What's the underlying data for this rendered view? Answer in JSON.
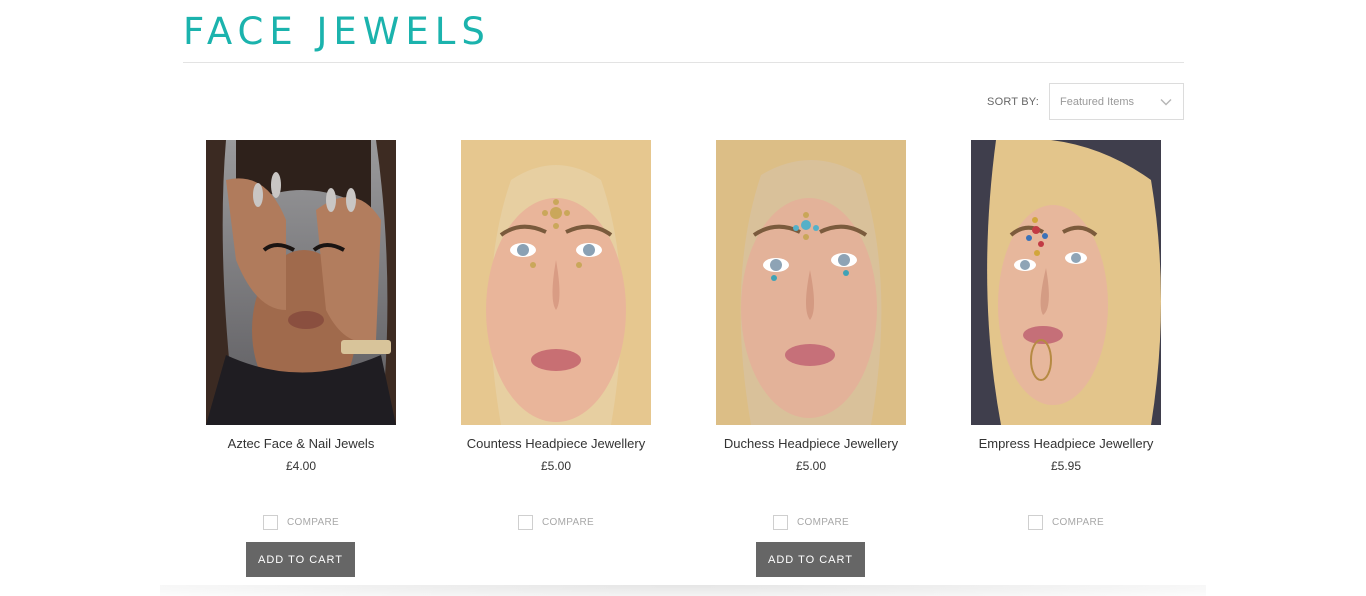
{
  "page": {
    "title": "FACE JEWELS",
    "accent_color": "#1bb3ad"
  },
  "sort": {
    "label": "SORT BY:",
    "selected": "Featured Items",
    "icon": "chevron-down-icon"
  },
  "products": [
    {
      "name": "Aztec Face & Nail Jewels",
      "price": "£4.00",
      "compare_label": "COMPARE",
      "cart_label": "ADD TO CART"
    },
    {
      "name": "Countess Headpiece Jewellery",
      "price": "£5.00",
      "compare_label": "COMPARE"
    },
    {
      "name": "Duchess Headpiece Jewellery",
      "price": "£5.00",
      "compare_label": "COMPARE",
      "cart_label": "ADD TO CART"
    },
    {
      "name": "Empress Headpiece Jewellery",
      "price": "£5.95",
      "compare_label": "COMPARE"
    }
  ]
}
